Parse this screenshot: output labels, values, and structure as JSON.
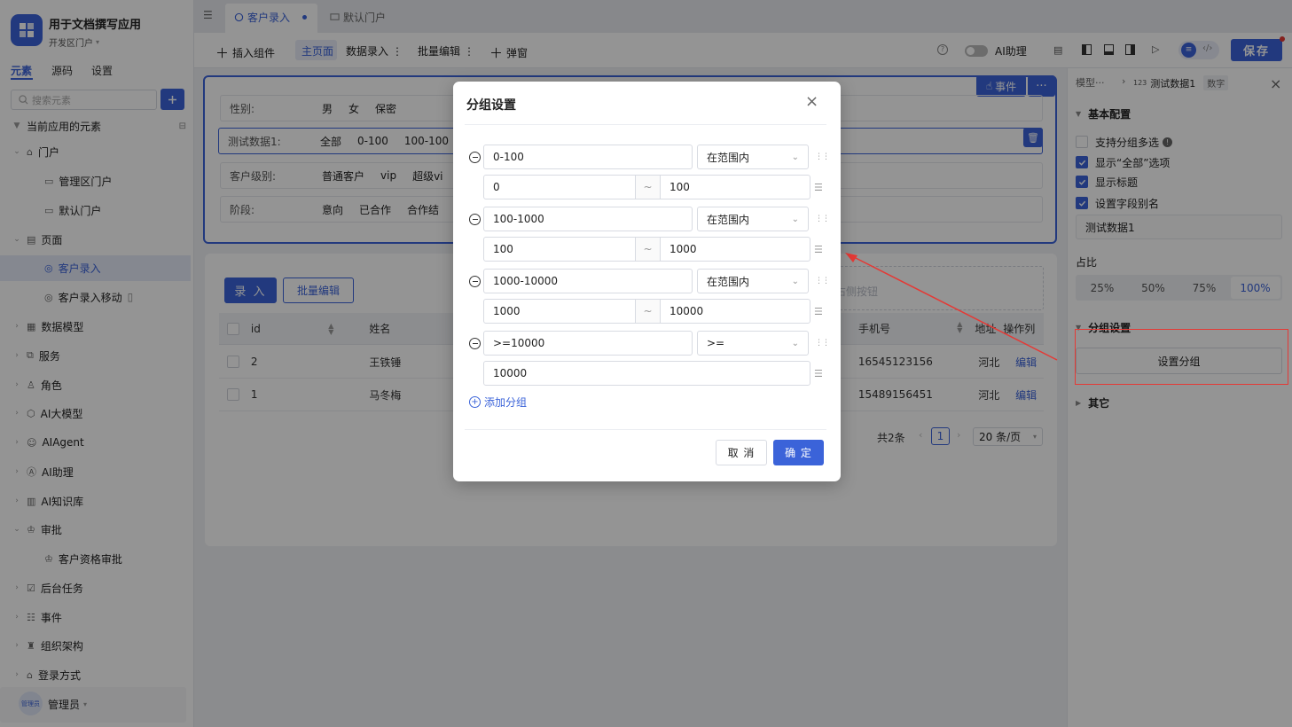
{
  "app": {
    "title": "用于文档撰写应用",
    "portal": "开发区门户"
  },
  "sidebar": {
    "tabs": [
      "元素",
      "源码",
      "设置"
    ],
    "search_placeholder": "搜索元素",
    "section_title": "当前应用的元素",
    "items": [
      {
        "label": "门户",
        "level": 0,
        "icon": "home-icon",
        "expanded": true
      },
      {
        "label": "管理区门户",
        "level": 1,
        "icon": "monitor-icon"
      },
      {
        "label": "默认门户",
        "level": 1,
        "icon": "monitor-icon"
      },
      {
        "label": "页面",
        "level": 0,
        "icon": "page-icon",
        "expanded": true
      },
      {
        "label": "客户录入",
        "level": 1,
        "icon": "form-icon",
        "selected": true
      },
      {
        "label": "客户录入移动",
        "level": 1,
        "icon": "form-icon",
        "mobile": true
      },
      {
        "label": "数据模型",
        "level": 0,
        "icon": "table-icon"
      },
      {
        "label": "服务",
        "level": 0,
        "icon": "service-icon"
      },
      {
        "label": "角色",
        "level": 0,
        "icon": "role-icon"
      },
      {
        "label": "AI大模型",
        "level": 0,
        "icon": "ai-model-icon"
      },
      {
        "label": "AIAgent",
        "level": 0,
        "icon": "robot-icon"
      },
      {
        "label": "AI助理",
        "level": 0,
        "icon": "ai-assistant-icon"
      },
      {
        "label": "AI知识库",
        "level": 0,
        "icon": "book-icon"
      },
      {
        "label": "审批",
        "level": 0,
        "icon": "stamp-icon",
        "expanded": true
      },
      {
        "label": "客户资格审批",
        "level": 1,
        "icon": "stamp-icon"
      },
      {
        "label": "后台任务",
        "level": 0,
        "icon": "task-icon"
      },
      {
        "label": "事件",
        "level": 0,
        "icon": "event-icon"
      },
      {
        "label": "组织架构",
        "level": 0,
        "icon": "org-icon"
      },
      {
        "label": "登录方式",
        "level": 0,
        "icon": "login-icon"
      }
    ],
    "user": {
      "name": "管理员",
      "avatar_text": "管理员"
    }
  },
  "tabs": [
    {
      "label": "客户录入",
      "active": true
    },
    {
      "label": "默认门户",
      "active": false
    }
  ],
  "toolbar": {
    "insert": "插入组件",
    "main_page": "主页面",
    "data_entry": "数据录入",
    "batch_edit": "批量编辑",
    "popup": "弹窗",
    "ai_assistant": "AI助理",
    "save": "保存"
  },
  "canvas": {
    "event_btn": "事件",
    "filters": [
      {
        "label": "性别:",
        "options": [
          "男",
          "女",
          "保密"
        ]
      },
      {
        "label": "测试数据1:",
        "options": [
          "全部",
          "0-100",
          "100-100"
        ]
      },
      {
        "label": "客户级别:",
        "options": [
          "普通客户",
          "vip",
          "超级vi"
        ]
      },
      {
        "label": "阶段:",
        "options": [
          "意向",
          "已合作",
          "合作结"
        ]
      }
    ],
    "entry_btn": "录 入",
    "batch_btn": "批量编辑",
    "side_btn_hint": "右侧按钮",
    "table": {
      "headers": [
        "id",
        "姓名",
        "手机号",
        "地址",
        "操作列"
      ],
      "rows": [
        {
          "id": "2",
          "name": "王铁锤",
          "phone": "16545123156",
          "addr": "河北",
          "action": "编辑"
        },
        {
          "id": "1",
          "name": "马冬梅",
          "phone": "15489156451",
          "addr": "河北",
          "action": "编辑"
        }
      ]
    },
    "pagination": {
      "total": "共2条",
      "page": "1",
      "page_size": "20 条/页"
    }
  },
  "rpanel": {
    "breadcrumb_model": "模型···",
    "field_name": "测试数据1",
    "field_type": "数字",
    "basic_section": "基本配置",
    "options": [
      {
        "label": "支持分组多选",
        "checked": false,
        "info": true
      },
      {
        "label": "显示“全部”选项",
        "checked": true
      },
      {
        "label": "显示标题",
        "checked": true
      },
      {
        "label": "设置字段别名",
        "checked": true
      }
    ],
    "alias_value": "测试数据1",
    "ratio_label": "占比",
    "ratios": [
      "25%",
      "50%",
      "75%",
      "100%"
    ],
    "ratio_selected": "100%",
    "group_section": "分组设置",
    "group_btn": "设置分组",
    "other_section": "其它"
  },
  "dialog": {
    "title": "分组设置",
    "groups": [
      {
        "name": "0-100",
        "op": "在范围内",
        "range": [
          "0",
          "100"
        ]
      },
      {
        "name": "100-1000",
        "op": "在范围内",
        "range": [
          "100",
          "1000"
        ]
      },
      {
        "name": "1000-10000",
        "op": "在范围内",
        "range": [
          "1000",
          "10000"
        ]
      },
      {
        "name": ">=10000",
        "op": ">=",
        "value": "10000"
      }
    ],
    "range_sep": "~",
    "add_group": "添加分组",
    "cancel": "取 消",
    "ok": "确 定"
  },
  "colors": {
    "accent": "#3b63d9",
    "annotation": "#e53935"
  }
}
